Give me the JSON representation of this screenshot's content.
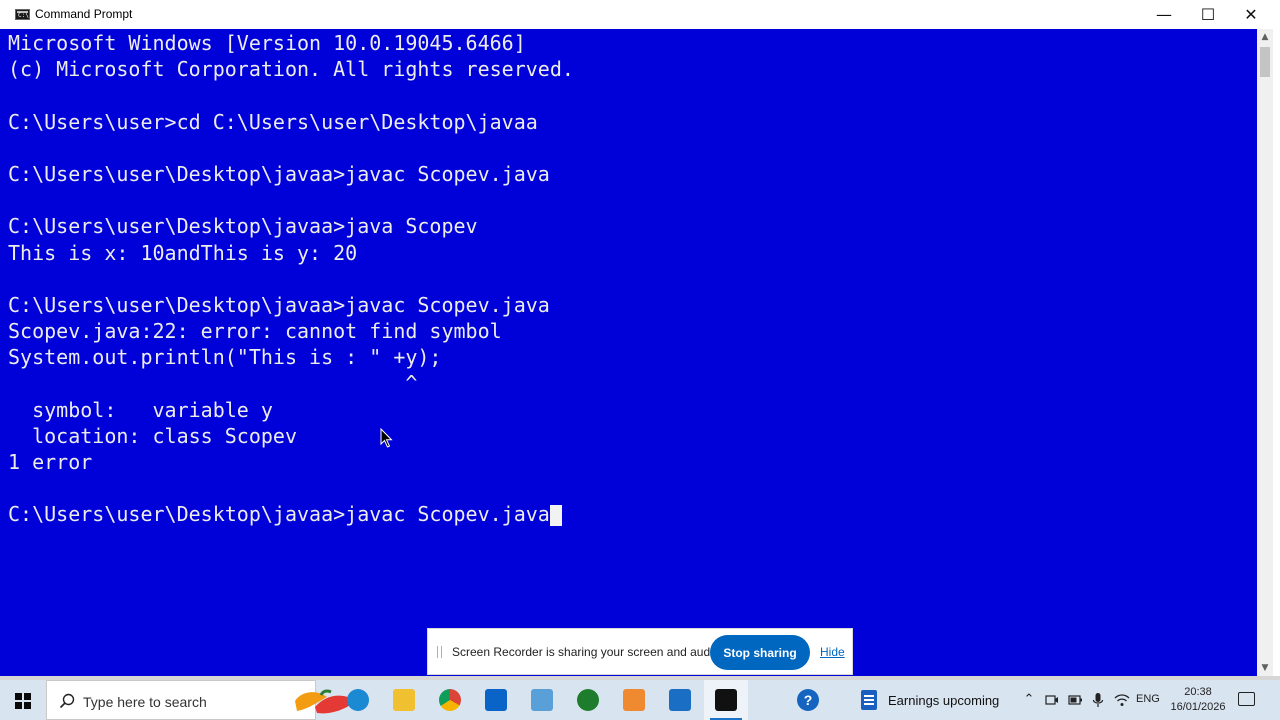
{
  "window": {
    "title": "Command Prompt",
    "minimize_glyph": "—",
    "maximize_glyph": "☐",
    "close_glyph": "✕"
  },
  "colors": {
    "console_background": "#0000d8",
    "console_text": "#ececec",
    "taskbar_background": "#d9e4f1",
    "accent": "#0067c0"
  },
  "console": {
    "lines": [
      "Microsoft Windows [Version 10.0.19045.6466]",
      "(c) Microsoft Corporation. All rights reserved.",
      "",
      "C:\\Users\\user>cd C:\\Users\\user\\Desktop\\javaa",
      "",
      "C:\\Users\\user\\Desktop\\javaa>javac Scopev.java",
      "",
      "C:\\Users\\user\\Desktop\\javaa>java Scopev",
      "This is x: 10andThis is y: 20",
      "",
      "C:\\Users\\user\\Desktop\\javaa>javac Scopev.java",
      "Scopev.java:22: error: cannot find symbol",
      "System.out.println(\"This is : \" +y);",
      "                                 ^",
      "  symbol:   variable y",
      "  location: class Scopev",
      "1 error",
      "",
      "C:\\Users\\user\\Desktop\\javaa>javac Scopev.java"
    ]
  },
  "scrollbar": {
    "up_arrow": "▲",
    "down_arrow": "▼"
  },
  "share_bar": {
    "message": "Screen Recorder is sharing your screen and audio.",
    "stop_label": "Stop sharing",
    "hide_label": "Hide"
  },
  "taskbar": {
    "search_placeholder": "Type here to search",
    "apps": [
      {
        "name": "edge-icon",
        "color": "#1b8ad3"
      },
      {
        "name": "file-explorer-icon",
        "color": "#f0c030"
      },
      {
        "name": "chrome-icon",
        "color": "#db4437"
      },
      {
        "name": "outlook-icon",
        "color": "#0a64c8"
      },
      {
        "name": "notepad-icon",
        "color": "#5aa0d8"
      },
      {
        "name": "green-app-icon",
        "color": "#1e7d2c"
      },
      {
        "name": "orange-app-icon",
        "color": "#f08a30"
      },
      {
        "name": "camera-app-icon",
        "color": "#1a6fc4"
      },
      {
        "name": "command-prompt-icon",
        "color": "#111111"
      }
    ],
    "help_glyph": "?",
    "news_label": "Earnings upcoming",
    "tray_chevron": "⌃",
    "language": "ENG",
    "time": "20:38",
    "date": "16/01/2026"
  }
}
